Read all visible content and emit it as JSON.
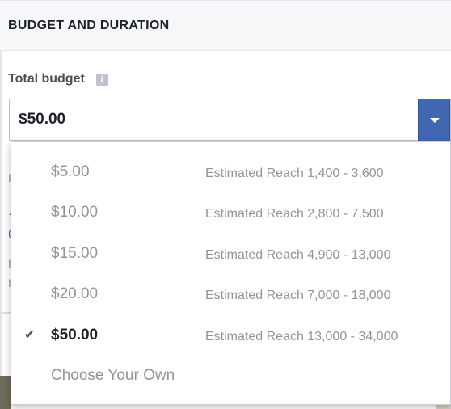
{
  "header": {
    "title": "BUDGET AND DURATION"
  },
  "budget": {
    "label": "Total budget",
    "info_icon": "info-icon",
    "selected_value": "$50.00",
    "dropdown_icon": "chevron-down-icon"
  },
  "dropdown": {
    "options": [
      {
        "price": "$5.00",
        "reach": "Estimated Reach 1,400 - 3,600"
      },
      {
        "price": "$10.00",
        "reach": "Estimated Reach 2,800 - 7,500"
      },
      {
        "price": "$15.00",
        "reach": "Estimated Reach 4,900 - 13,000"
      },
      {
        "price": "$20.00",
        "reach": "Estimated Reach 7,000 - 18,000"
      },
      {
        "price": "$50.00",
        "reach": "Estimated Reach 13,000 - 34,000",
        "selected": true,
        "check": "✔"
      },
      {
        "price": "Choose Your Own"
      }
    ]
  },
  "colors": {
    "accent": "#4267b2",
    "muted_text": "#90949c",
    "primary_text": "#1d2129"
  }
}
